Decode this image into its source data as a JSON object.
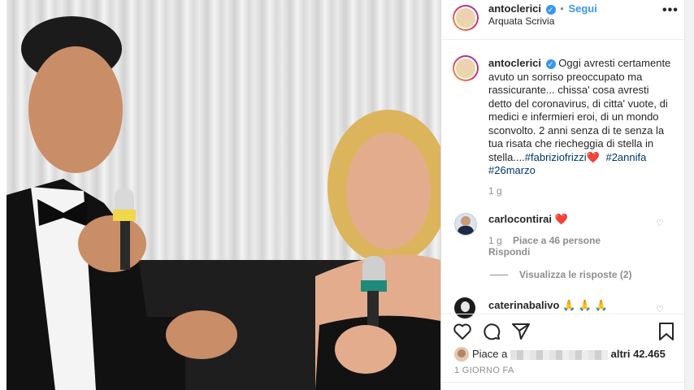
{
  "post": {
    "username": "antoclerici",
    "follow_label": "Segui",
    "location": "Arquata Scrivia",
    "more_icon": "more-options-icon"
  },
  "caption": {
    "username": "antoclerici",
    "lines": [
      "Oggi avresti certamente",
      "avuto un sorriso preoccupato ma",
      "rassicurante... chissa' cosa avresti",
      "detto del coronavirus, di citta' vuote, di",
      "medici e infermieri eroi, di un mondo",
      "sconvolto. 2 anni senza di te senza la",
      "tua risata che riecheggia di stella in"
    ],
    "last_line_text": "stella....",
    "hashtag1": "#fabriziofrizzi",
    "emoji1": "❤️",
    "hashtag2": "#2annifa",
    "hashtag3": "#26marzo",
    "time": "1 g"
  },
  "comments": [
    {
      "username": "carlocontirai",
      "text": "❤️",
      "time": "1 g",
      "likes": "Piace a 46 persone",
      "reply": "Rispondi",
      "view_replies": "Visualizza le risposte (2)"
    },
    {
      "username": "caterinabalivo",
      "text": "🙏 🙏 🙏"
    }
  ],
  "actions": {
    "like_icon": "heart-icon",
    "comment_icon": "comment-icon",
    "share_icon": "share-icon",
    "save_icon": "bookmark-icon"
  },
  "likes": {
    "prefix": "Piace a",
    "suffix": "altri 42.465"
  },
  "date": "1 GIORNO FA",
  "colors": {
    "accent": "#3897f0",
    "hashtag": "#00376b",
    "muted": "#8e8e8e"
  }
}
